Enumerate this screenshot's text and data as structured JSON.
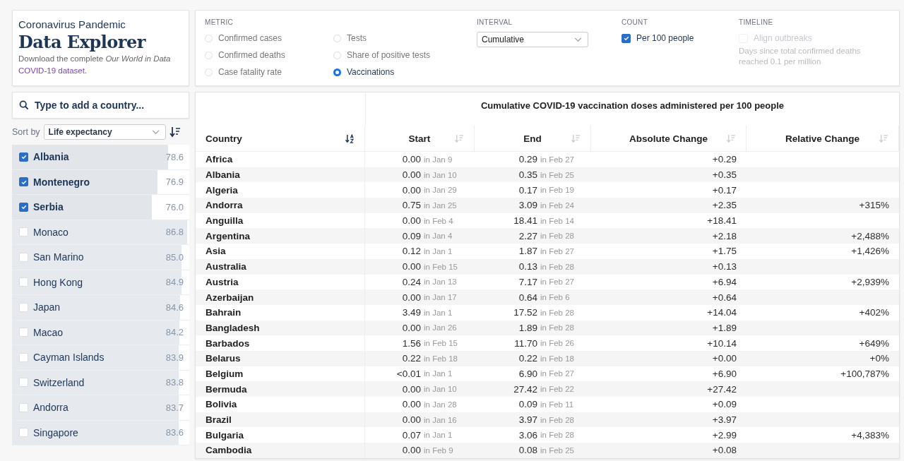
{
  "header": {
    "subtitle": "Coronavirus Pandemic",
    "title": "Data Explorer",
    "description": "Download the complete *Our World in Data*",
    "link": "COVID-19 dataset."
  },
  "controls": {
    "metric": {
      "label": "METRIC",
      "options": [
        {
          "label": "Confirmed cases",
          "selected": false
        },
        {
          "label": "Confirmed deaths",
          "selected": false
        },
        {
          "label": "Case fatality rate",
          "selected": false
        },
        {
          "label": "Tests",
          "selected": false
        },
        {
          "label": "Share of positive tests",
          "selected": false
        },
        {
          "label": "Vaccinations",
          "selected": true
        }
      ]
    },
    "interval": {
      "label": "INTERVAL",
      "value": "Cumulative"
    },
    "count": {
      "label": "COUNT",
      "option": {
        "label": "Per 100 people",
        "checked": true
      }
    },
    "timeline": {
      "label": "TIMELINE",
      "option": {
        "label": "Align outbreaks",
        "checked": false,
        "disabled": true
      },
      "note": "Days since total confirmed deaths reached 0.1 per million"
    }
  },
  "sidebar": {
    "search": {
      "placeholder": "Type to add a country..."
    },
    "sort_label": "Sort by",
    "sort_value": "Life expectancy",
    "countries": [
      {
        "name": "Albania",
        "value": "78.6",
        "checked": true,
        "level": 0.88
      },
      {
        "name": "Montenegro",
        "value": "76.9",
        "checked": true,
        "level": 0.82
      },
      {
        "name": "Serbia",
        "value": "76.0",
        "checked": true,
        "level": 0.79
      },
      {
        "name": "Monaco",
        "value": "86.8",
        "checked": false,
        "level": 0.99
      },
      {
        "name": "San Marino",
        "value": "85.0",
        "checked": false,
        "level": 0.955
      },
      {
        "name": "Hong Kong",
        "value": "84.9",
        "checked": false,
        "level": 0.955
      },
      {
        "name": "Japan",
        "value": "84.6",
        "checked": false,
        "level": 0.95
      },
      {
        "name": "Macao",
        "value": "84.2",
        "checked": false,
        "level": 0.945
      },
      {
        "name": "Cayman Islands",
        "value": "83.9",
        "checked": false,
        "level": 0.94
      },
      {
        "name": "Switzerland",
        "value": "83.8",
        "checked": false,
        "level": 0.94
      },
      {
        "name": "Andorra",
        "value": "83.7",
        "checked": false,
        "level": 0.94
      },
      {
        "name": "Singapore",
        "value": "83.6",
        "checked": false,
        "level": 0.94
      }
    ]
  },
  "table": {
    "title": "Cumulative COVID-19 vaccination doses administered per 100 people",
    "columns": [
      {
        "label": "Country",
        "sort_active": true
      },
      {
        "label": "Start",
        "sort_active": false
      },
      {
        "label": "End",
        "sort_active": false
      },
      {
        "label": "Absolute Change",
        "sort_active": false
      },
      {
        "label": "Relative Change",
        "sort_active": false
      }
    ],
    "rows": [
      {
        "country": "Africa",
        "start": "0.00",
        "start_date": "in Jan 9",
        "end": "0.29",
        "end_date": "in Feb 27",
        "abs": "+0.29"
      },
      {
        "country": "Albania",
        "start": "0.00",
        "start_date": "in Jan 10",
        "end": "0.35",
        "end_date": "in Feb 25",
        "abs": "+0.35"
      },
      {
        "country": "Algeria",
        "start": "0.00",
        "start_date": "in Jan 29",
        "end": "0.17",
        "end_date": "in Feb 19",
        "abs": "+0.17"
      },
      {
        "country": "Andorra",
        "start": "0.75",
        "start_date": "in Jan 25",
        "end": "3.09",
        "end_date": "in Feb 24",
        "abs": "+2.35",
        "rel": "+315%"
      },
      {
        "country": "Anguilla",
        "start": "0.00",
        "start_date": "in Feb 4",
        "end": "18.41",
        "end_date": "in Feb 14",
        "abs": "+18.41"
      },
      {
        "country": "Argentina",
        "start": "0.09",
        "start_date": "in Jan 4",
        "end": "2.27",
        "end_date": "in Feb 28",
        "abs": "+2.18",
        "rel": "+2,488%"
      },
      {
        "country": "Asia",
        "start": "0.12",
        "start_date": "in Jan 1",
        "end": "1.87",
        "end_date": "in Feb 27",
        "abs": "+1.75",
        "rel": "+1,426%"
      },
      {
        "country": "Australia",
        "start": "0.00",
        "start_date": "in Feb 15",
        "end": "0.13",
        "end_date": "in Feb 28",
        "abs": "+0.13"
      },
      {
        "country": "Austria",
        "start": "0.24",
        "start_date": "in Jan 13",
        "end": "7.17",
        "end_date": "in Feb 27",
        "abs": "+6.94",
        "rel": "+2,939%"
      },
      {
        "country": "Azerbaijan",
        "start": "0.00",
        "start_date": "in Jan 17",
        "end": "0.64",
        "end_date": "in Feb 6",
        "abs": "+0.64"
      },
      {
        "country": "Bahrain",
        "start": "3.49",
        "start_date": "in Jan 1",
        "end": "17.52",
        "end_date": "in Feb 28",
        "abs": "+14.04",
        "rel": "+402%"
      },
      {
        "country": "Bangladesh",
        "start": "0.00",
        "start_date": "in Jan 26",
        "end": "1.89",
        "end_date": "in Feb 28",
        "abs": "+1.89"
      },
      {
        "country": "Barbados",
        "start": "1.56",
        "start_date": "in Feb 15",
        "end": "11.70",
        "end_date": "in Feb 26",
        "abs": "+10.14",
        "rel": "+649%"
      },
      {
        "country": "Belarus",
        "start": "0.22",
        "start_date": "in Feb 18",
        "end": "0.22",
        "end_date": "in Feb 18",
        "abs": "+0.00",
        "rel": "+0%"
      },
      {
        "country": "Belgium",
        "start": "<0.01",
        "start_date": "in Jan 1",
        "end": "6.90",
        "end_date": "in Feb 27",
        "abs": "+6.90",
        "rel": "+100,787%"
      },
      {
        "country": "Bermuda",
        "start": "0.00",
        "start_date": "in Jan 10",
        "end": "27.42",
        "end_date": "in Feb 22",
        "abs": "+27.42"
      },
      {
        "country": "Bolivia",
        "start": "0.00",
        "start_date": "in Jan 28",
        "end": "0.09",
        "end_date": "in Feb 11",
        "abs": "+0.09"
      },
      {
        "country": "Brazil",
        "start": "0.00",
        "start_date": "in Jan 16",
        "end": "3.97",
        "end_date": "in Feb 28",
        "abs": "+3.97"
      },
      {
        "country": "Bulgaria",
        "start": "0.07",
        "start_date": "in Jan 1",
        "end": "3.06",
        "end_date": "in Feb 28",
        "abs": "+2.99",
        "rel": "+4,383%"
      },
      {
        "country": "Cambodia",
        "start": "0.00",
        "start_date": "in Feb 9",
        "end": "0.08",
        "end_date": "in Feb 25",
        "abs": "+0.08"
      }
    ]
  }
}
